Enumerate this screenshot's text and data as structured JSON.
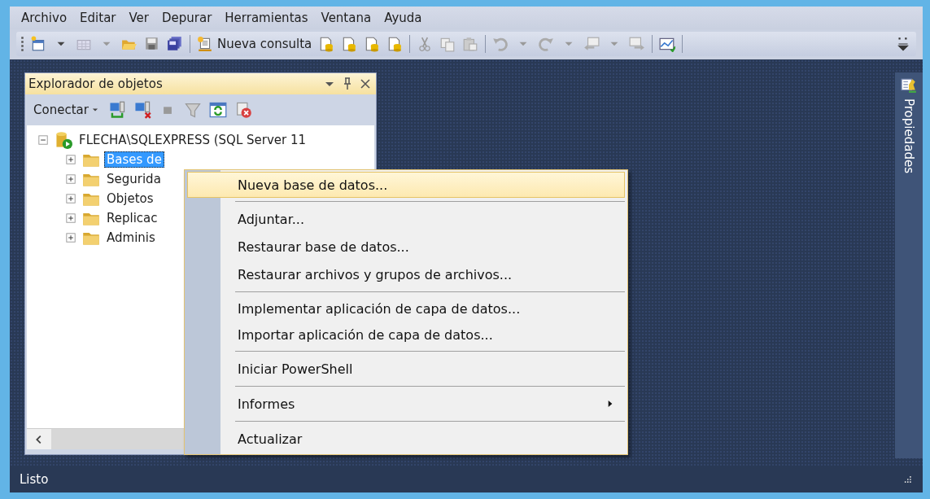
{
  "menu_bar": [
    "Archivo",
    "Editar",
    "Ver",
    "Depurar",
    "Herramientas",
    "Ventana",
    "Ayuda"
  ],
  "toolbar": {
    "new_query_label": "Nueva consulta"
  },
  "object_explorer": {
    "title": "Explorador de objetos",
    "connect_label": "Conectar",
    "tree": [
      {
        "label": "FLECHA\\SQLEXPRESS (SQL Server 11",
        "kind": "server",
        "expanded": true,
        "selected": false,
        "children": [
          {
            "label": "Bases de",
            "kind": "folder",
            "expanded": false,
            "selected": true
          },
          {
            "label": "Segurida",
            "kind": "folder",
            "expanded": false,
            "selected": false
          },
          {
            "label": "Objetos",
            "kind": "folder",
            "expanded": false,
            "selected": false
          },
          {
            "label": "Replicac",
            "kind": "folder",
            "expanded": false,
            "selected": false
          },
          {
            "label": "Adminis",
            "kind": "folder",
            "expanded": false,
            "selected": false
          }
        ]
      }
    ]
  },
  "side_tab": {
    "label": "Propiedades"
  },
  "context_menu": {
    "groups": [
      [
        {
          "label": "Nueva base de datos...",
          "selected": true,
          "submenu": false
        }
      ],
      [
        {
          "label": "Adjuntar...",
          "selected": false,
          "submenu": false
        },
        {
          "label": "Restaurar base de datos...",
          "selected": false,
          "submenu": false
        },
        {
          "label": "Restaurar archivos y grupos de archivos...",
          "selected": false,
          "submenu": false
        }
      ],
      [
        {
          "label": "Implementar aplicación de capa de datos...",
          "selected": false,
          "submenu": false
        },
        {
          "label": "Importar aplicación de capa de datos...",
          "selected": false,
          "submenu": false
        }
      ],
      [
        {
          "label": "Iniciar PowerShell",
          "selected": false,
          "submenu": false
        }
      ],
      [
        {
          "label": "Informes",
          "selected": false,
          "submenu": true
        }
      ],
      [
        {
          "label": "Actualizar",
          "selected": false,
          "submenu": false
        }
      ]
    ]
  },
  "status_bar": {
    "text": "Listo"
  }
}
